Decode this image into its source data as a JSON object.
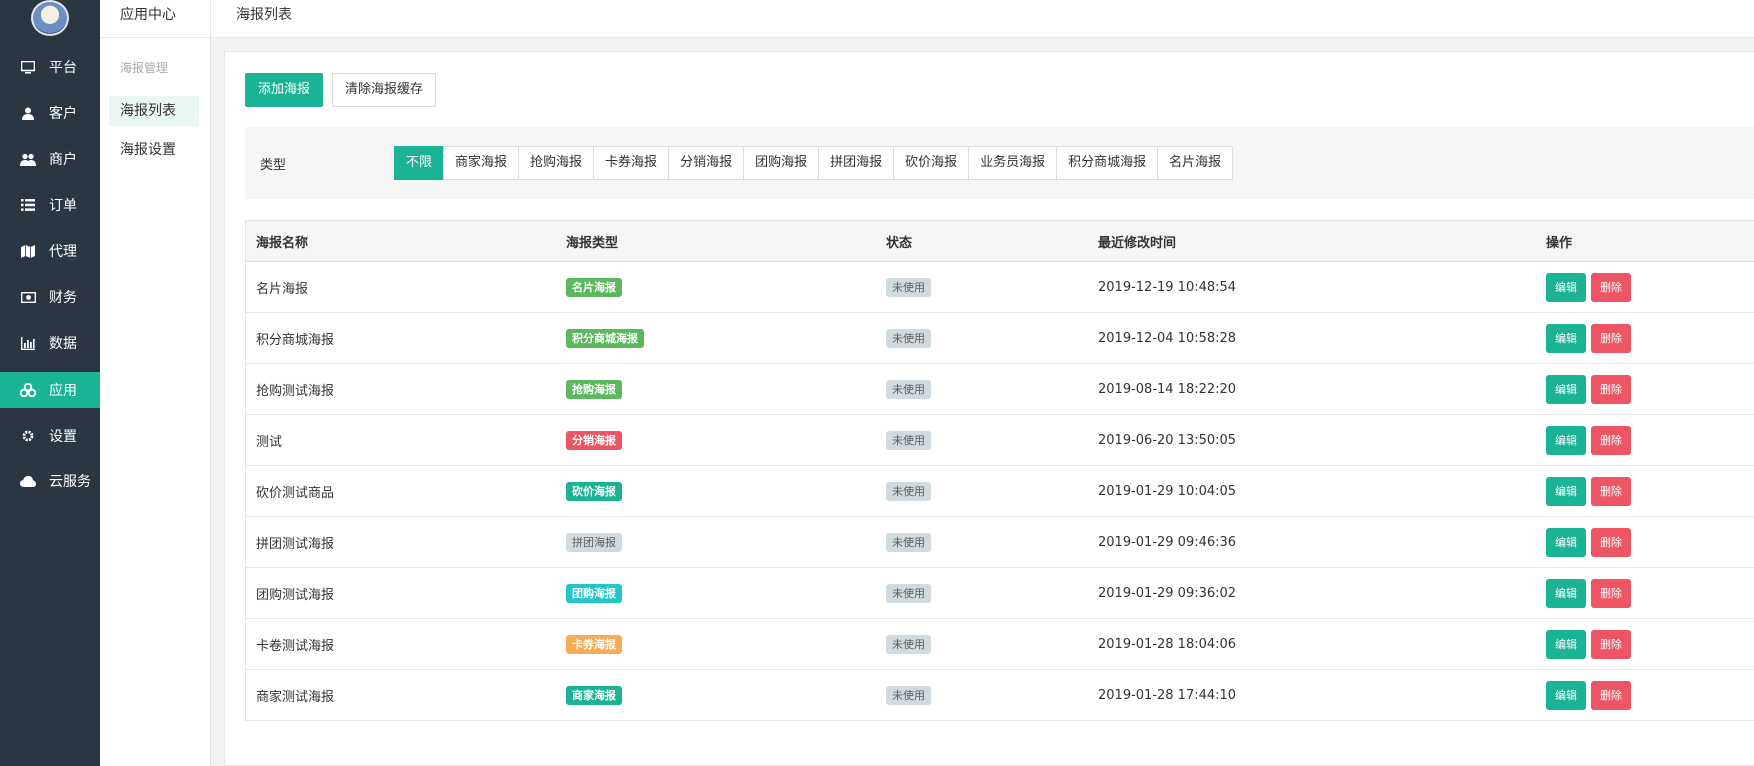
{
  "colors": {
    "accent": "#1ab394",
    "danger": "#ed5565",
    "sidebar_bg": "#2b3643"
  },
  "nav": [
    {
      "label": "平台",
      "icon": "monitor-icon"
    },
    {
      "label": "客户",
      "icon": "user-icon"
    },
    {
      "label": "商户",
      "icon": "users-icon"
    },
    {
      "label": "订单",
      "icon": "list-icon"
    },
    {
      "label": "代理",
      "icon": "map-icon"
    },
    {
      "label": "财务",
      "icon": "money-icon"
    },
    {
      "label": "数据",
      "icon": "bar-chart-icon"
    },
    {
      "label": "应用",
      "icon": "cubes-icon",
      "active": true
    },
    {
      "label": "设置",
      "icon": "gear-icon"
    },
    {
      "label": "云服务",
      "icon": "cloud-icon"
    }
  ],
  "subnav": {
    "title": "应用中心",
    "group": "海报管理",
    "items": [
      {
        "label": "海报列表",
        "active": true
      },
      {
        "label": "海报设置"
      }
    ]
  },
  "header": {
    "title": "海报列表"
  },
  "toolbar": {
    "add_label": "添加海报",
    "clear_label": "清除海报缓存"
  },
  "filter": {
    "label": "类型",
    "options": [
      "不限",
      "商家海报",
      "抢购海报",
      "卡券海报",
      "分销海报",
      "团购海报",
      "拼团海报",
      "砍价海报",
      "业务员海报",
      "积分商城海报",
      "名片海报"
    ],
    "selected": "不限"
  },
  "table": {
    "columns": [
      "海报名称",
      "海报类型",
      "状态",
      "最近修改时间",
      "操作"
    ],
    "edit_label": "编辑",
    "delete_label": "删除",
    "rows": [
      {
        "name": "名片海报",
        "type": "名片海报",
        "type_color": "#5cb85c",
        "status": "未使用",
        "time": "2019-12-19 10:48:54"
      },
      {
        "name": "积分商城海报",
        "type": "积分商城海报",
        "type_color": "#5cb85c",
        "status": "未使用",
        "time": "2019-12-04 10:58:28"
      },
      {
        "name": "抢购测试海报",
        "type": "抢购海报",
        "type_color": "#5cb85c",
        "status": "未使用",
        "time": "2019-08-14 18:22:20"
      },
      {
        "name": "测试",
        "type": "分销海报",
        "type_color": "#ed5565",
        "status": "未使用",
        "time": "2019-06-20 13:50:05"
      },
      {
        "name": "砍价测试商品",
        "type": "砍价海报",
        "type_color": "#1ab394",
        "status": "未使用",
        "time": "2019-01-29 10:04:05"
      },
      {
        "name": "拼团测试海报",
        "type": "拼团海报",
        "type_color": "#d1dade",
        "status": "未使用",
        "time": "2019-01-29 09:46:36"
      },
      {
        "name": "团购测试海报",
        "type": "团购海报",
        "type_color": "#23c6c8",
        "status": "未使用",
        "time": "2019-01-29 09:36:02"
      },
      {
        "name": "卡卷测试海报",
        "type": "卡券海报",
        "type_color": "#f8ac59",
        "status": "未使用",
        "time": "2019-01-28 18:04:06"
      },
      {
        "name": "商家测试海报",
        "type": "商家海报",
        "type_color": "#1ab394",
        "status": "未使用",
        "time": "2019-01-28 17:44:10"
      }
    ]
  }
}
